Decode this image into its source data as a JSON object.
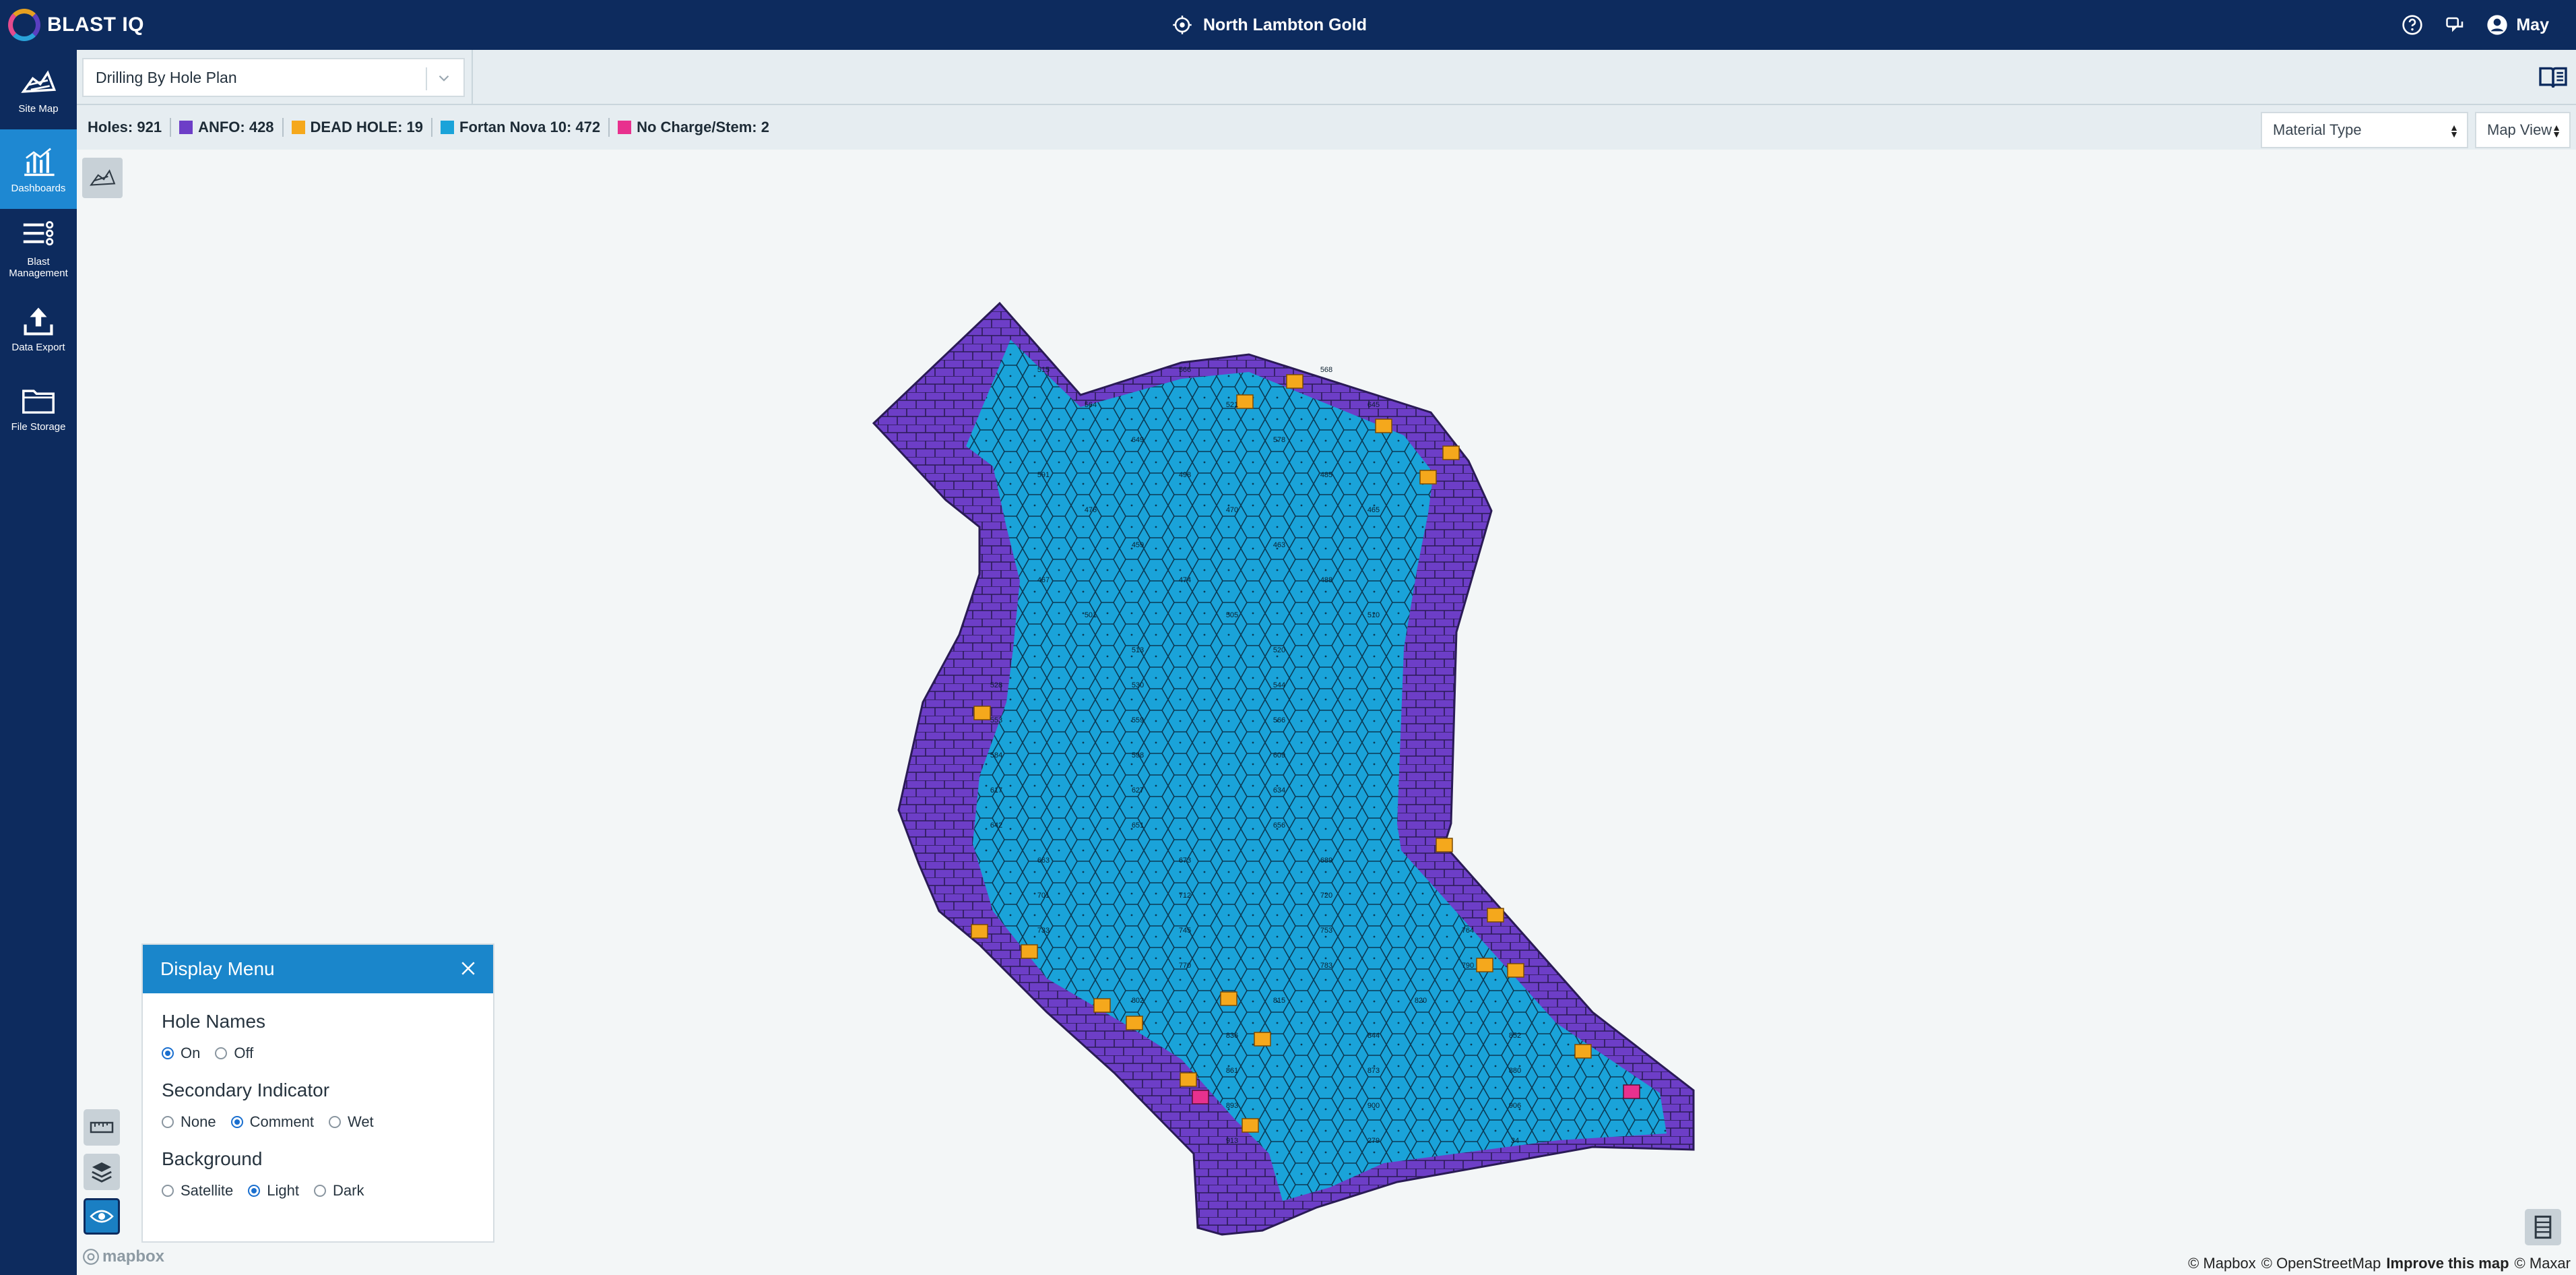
{
  "app": {
    "name": "BLAST IQ"
  },
  "header": {
    "site": "North Lambton Gold",
    "user": "May"
  },
  "rail": [
    {
      "label": "Site Map",
      "icon": "site-map-icon",
      "active": false
    },
    {
      "label": "Dashboards",
      "icon": "dashboards-icon",
      "active": true
    },
    {
      "label": "Blast Management",
      "icon": "blast-management-icon",
      "active": false
    },
    {
      "label": "Data Export",
      "icon": "data-export-icon",
      "active": false
    },
    {
      "label": "File Storage",
      "icon": "file-storage-icon",
      "active": false
    }
  ],
  "toolbar": {
    "plan": "Drilling By Hole Plan"
  },
  "legend": {
    "holes": "Holes: 921",
    "items": [
      {
        "label": "ANFO: 428",
        "color": "#6d3ec7"
      },
      {
        "label": "DEAD HOLE: 19",
        "color": "#f5a81c"
      },
      {
        "label": "Fortan Nova 10: 472",
        "color": "#1aa3d9"
      },
      {
        "label": "No Charge/Stem: 2",
        "color": "#e8318e"
      }
    ]
  },
  "controls": {
    "color_by": "Material Type",
    "view": "Map View"
  },
  "display_menu": {
    "title": "Display Menu",
    "sections": [
      {
        "title": "Hole Names",
        "options": [
          "On",
          "Off"
        ],
        "selected": "On"
      },
      {
        "title": "Secondary Indicator",
        "options": [
          "None",
          "Comment",
          "Wet"
        ],
        "selected": "Comment"
      },
      {
        "title": "Background",
        "options": [
          "Satellite",
          "Light",
          "Dark"
        ],
        "selected": "Light"
      }
    ]
  },
  "attribution": {
    "mapbox": "© Mapbox",
    "osm": "© OpenStreetMap",
    "improve": "Improve this map",
    "maxar": "© Maxar",
    "logo": "mapbox"
  },
  "map": {
    "hole_labels": [
      "515",
      "566",
      "568",
      "564",
      "521",
      "645",
      "649",
      "578",
      "591",
      "498",
      "485",
      "476",
      "470",
      "465",
      "459",
      "463",
      "467",
      "474",
      "488",
      "501",
      "505",
      "510",
      "513",
      "520",
      "528",
      "530",
      "544",
      "553",
      "559",
      "566",
      "584",
      "598",
      "609",
      "617",
      "627",
      "634",
      "642",
      "651",
      "656",
      "663",
      "673",
      "689",
      "701",
      "712",
      "720",
      "733",
      "745",
      "753",
      "764",
      "770",
      "783",
      "790",
      "802",
      "815",
      "820",
      "836",
      "844",
      "852",
      "861",
      "873",
      "880",
      "893",
      "900",
      "906",
      "913",
      "279",
      "34"
    ]
  }
}
